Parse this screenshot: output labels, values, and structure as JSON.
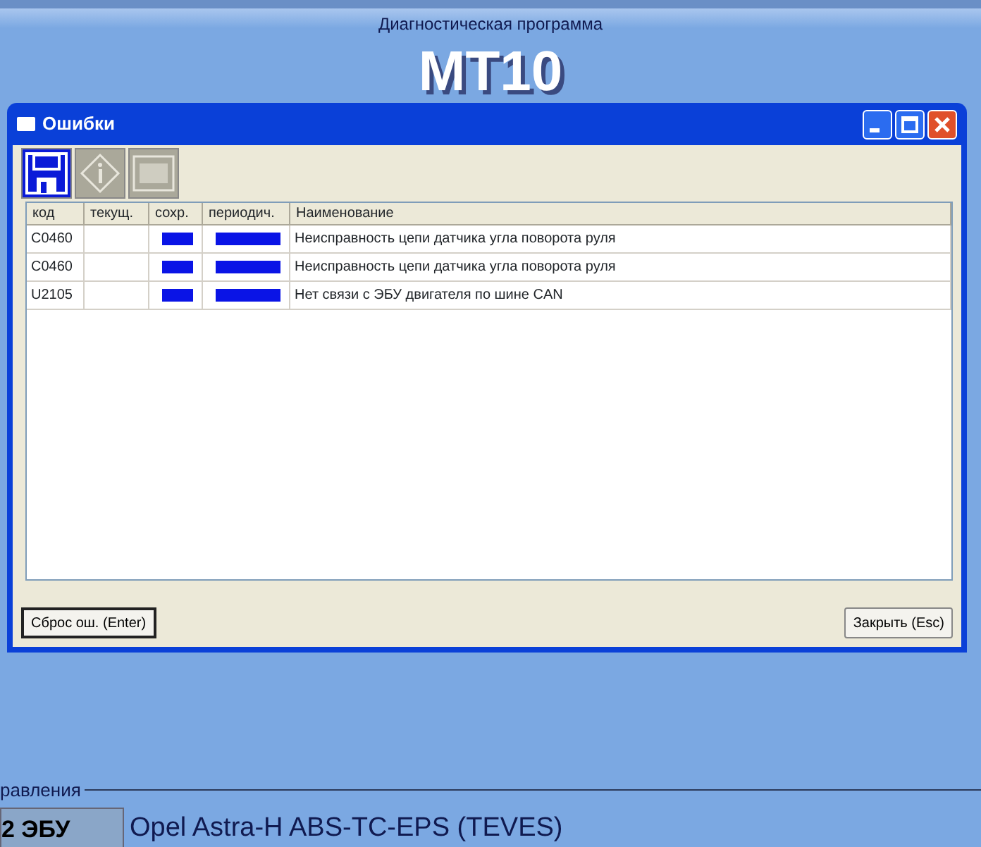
{
  "app": {
    "subtitle": "Диагностическая программа",
    "title": "MT10"
  },
  "dialog": {
    "title": "Ошибки",
    "toolbar": [
      {
        "kind": "save",
        "disabled": false
      },
      {
        "kind": "info",
        "disabled": true
      },
      {
        "kind": "film",
        "disabled": true
      }
    ],
    "columns": [
      "код",
      "текущ.",
      "сохр.",
      "периодич.",
      "Наименование"
    ],
    "rows": [
      {
        "code": "C0460",
        "current": false,
        "stored": true,
        "periodic": true,
        "name": "Неисправность цепи датчика угла поворота руля"
      },
      {
        "code": "C0460",
        "current": false,
        "stored": true,
        "periodic": true,
        "name": "Неисправность цепи датчика угла поворота руля"
      },
      {
        "code": "U2105",
        "current": false,
        "stored": true,
        "periodic": true,
        "name": "Нет связи с ЭБУ двигателя по шине CAN"
      }
    ],
    "buttons": [
      {
        "label": "Сброс ош. (Enter)",
        "selected": true
      },
      {
        "label": "Закрыть (Esc)",
        "selected": false
      }
    ]
  },
  "footer": {
    "legend": "равления",
    "button": "2 ЭБУ",
    "vehicle": "Opel Astra-H ABS-TC-EPS (TEVES)"
  }
}
